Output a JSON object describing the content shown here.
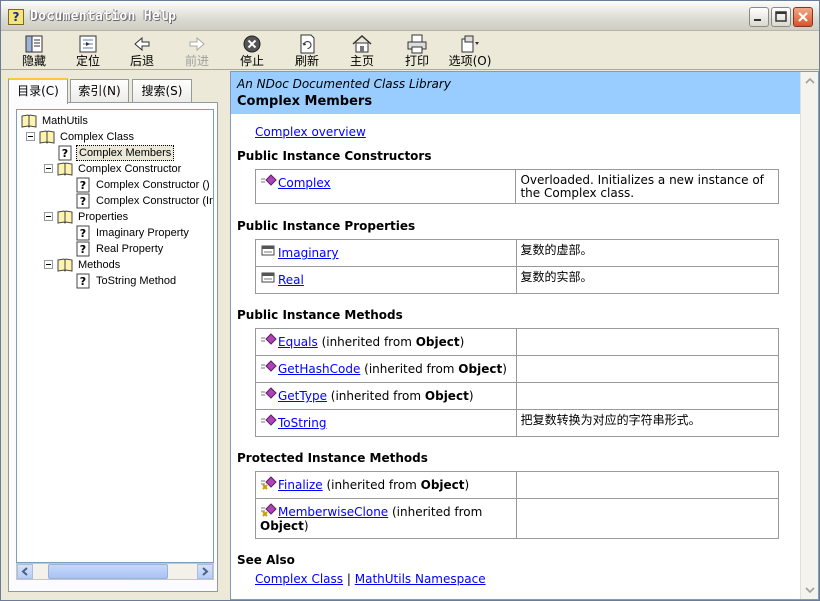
{
  "window": {
    "title": "Documentation Help"
  },
  "toolbar": {
    "items": [
      {
        "label": "隐藏",
        "icon": "hide-icon",
        "enabled": true
      },
      {
        "label": "定位",
        "icon": "locate-icon",
        "enabled": true
      },
      {
        "label": "后退",
        "icon": "back-arrow-icon",
        "enabled": true
      },
      {
        "label": "前进",
        "icon": "forward-arrow-icon",
        "enabled": false
      },
      {
        "label": "停止",
        "icon": "stop-icon",
        "enabled": true
      },
      {
        "label": "刷新",
        "icon": "refresh-icon",
        "enabled": true
      },
      {
        "label": "主页",
        "icon": "home-icon",
        "enabled": true
      },
      {
        "label": "打印",
        "icon": "printer-icon",
        "enabled": true
      },
      {
        "label": "选项(O)",
        "icon": "options-icon",
        "enabled": true
      }
    ]
  },
  "tabs": [
    {
      "label": "目录(C)",
      "active": true
    },
    {
      "label": "索引(N)",
      "active": false
    },
    {
      "label": "搜索(S)",
      "active": false
    }
  ],
  "tree": {
    "items": [
      {
        "label": "MathUtils",
        "type": "book"
      },
      {
        "label": "Complex Class",
        "type": "book"
      },
      {
        "label": "Complex Members",
        "type": "page",
        "selected": true
      },
      {
        "label": "Complex Constructor",
        "type": "book"
      },
      {
        "label": "Complex Constructor ()",
        "type": "page"
      },
      {
        "label": "Complex Constructor (In",
        "type": "page"
      },
      {
        "label": "Properties",
        "type": "book"
      },
      {
        "label": "Imaginary Property",
        "type": "page"
      },
      {
        "label": "Real Property",
        "type": "page"
      },
      {
        "label": "Methods",
        "type": "book"
      },
      {
        "label": "ToString Method",
        "type": "page"
      }
    ]
  },
  "content": {
    "subtitle": "An NDoc Documented Class Library",
    "title": "Complex Members",
    "overview_link": "Complex overview",
    "sections": {
      "constructors": {
        "heading": "Public Instance Constructors",
        "rows": [
          {
            "name": "Complex",
            "inherited": "",
            "from": "",
            "close": "",
            "desc": "Overloaded. Initializes a new instance of the Complex class."
          }
        ]
      },
      "properties": {
        "heading": "Public Instance Properties",
        "rows": [
          {
            "name": "Imaginary",
            "inherited": "",
            "from": "",
            "close": "",
            "desc": "复数的虚部。"
          },
          {
            "name": "Real",
            "inherited": "",
            "from": "",
            "close": "",
            "desc": "复数的实部。"
          }
        ]
      },
      "methods": {
        "heading": "Public Instance Methods",
        "rows": [
          {
            "name": "Equals",
            "inherited": " (inherited from ",
            "from": "Object",
            "close": ")",
            "desc": ""
          },
          {
            "name": "GetHashCode",
            "inherited": " (inherited from ",
            "from": "Object",
            "close": ")",
            "desc": ""
          },
          {
            "name": "GetType",
            "inherited": " (inherited from ",
            "from": "Object",
            "close": ")",
            "desc": ""
          },
          {
            "name": "ToString",
            "inherited": "",
            "from": "",
            "close": "",
            "desc": "把复数转换为对应的字符串形式。"
          }
        ]
      },
      "protected_methods": {
        "heading": "Protected Instance Methods",
        "rows": [
          {
            "name": "Finalize",
            "inherited": " (inherited from ",
            "from": "Object",
            "close": ")",
            "desc": ""
          },
          {
            "name": "MemberwiseClone",
            "inherited": " (inherited from ",
            "from": "Object",
            "close": ")",
            "desc": ""
          }
        ]
      }
    },
    "see_also": {
      "heading": "See Also",
      "link1": "Complex Class",
      "separator": "|",
      "link2": "MathUtils Namespace"
    }
  },
  "colors": {
    "banner": "#99CCFF",
    "link": "#0000FF",
    "chrome": "#ECE9D8"
  }
}
